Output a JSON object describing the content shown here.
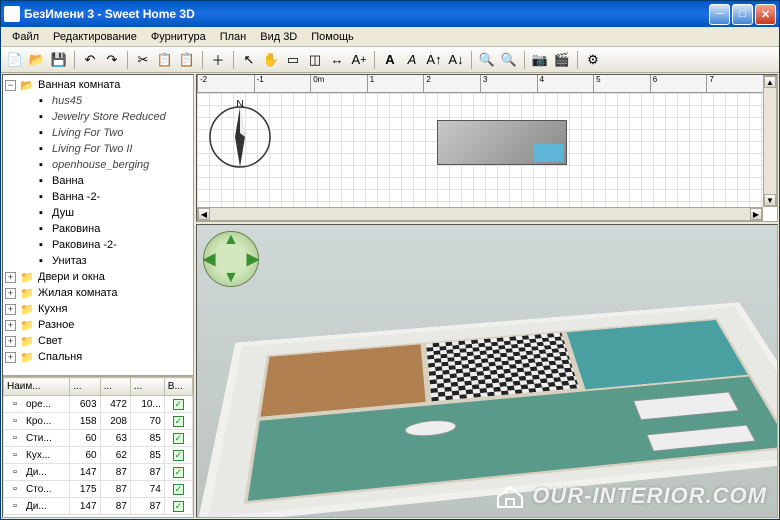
{
  "window": {
    "title": "БезИмени 3 - Sweet Home 3D"
  },
  "menu": {
    "file": "Файл",
    "edit": "Редактирование",
    "furniture": "Фурнитура",
    "plan": "План",
    "view3d": "Вид 3D",
    "help": "Помощь"
  },
  "tree": {
    "root": "Ванная комната",
    "items": [
      {
        "label": "hus45",
        "italic": true
      },
      {
        "label": "Jewelry Store Reduced",
        "italic": true
      },
      {
        "label": "Living For Two",
        "italic": true
      },
      {
        "label": "Living For Two II",
        "italic": true
      },
      {
        "label": "openhouse_berging",
        "italic": true
      },
      {
        "label": "Ванна",
        "italic": false
      },
      {
        "label": "Ванна -2-",
        "italic": false
      },
      {
        "label": "Душ",
        "italic": false
      },
      {
        "label": "Раковина",
        "italic": false
      },
      {
        "label": "Раковина -2-",
        "italic": false
      },
      {
        "label": "Унитаз",
        "italic": false
      }
    ],
    "siblings": [
      "Двери и окна",
      "Жилая комната",
      "Кухня",
      "Разное",
      "Свет",
      "Спальня"
    ]
  },
  "table": {
    "headers": [
      "Наим...",
      "...",
      "...",
      "...",
      "В..."
    ],
    "rows": [
      {
        "name": "ope...",
        "c1": "603",
        "c2": "472",
        "c3": "10...",
        "vis": true
      },
      {
        "name": "Кро...",
        "c1": "158",
        "c2": "208",
        "c3": "70",
        "vis": true
      },
      {
        "name": "Сти...",
        "c1": "60",
        "c2": "63",
        "c3": "85",
        "vis": true
      },
      {
        "name": "Кух...",
        "c1": "60",
        "c2": "62",
        "c3": "85",
        "vis": true
      },
      {
        "name": "Ди...",
        "c1": "147",
        "c2": "87",
        "c3": "87",
        "vis": true
      },
      {
        "name": "Сто...",
        "c1": "175",
        "c2": "87",
        "c3": "74",
        "vis": true
      },
      {
        "name": "Ди...",
        "c1": "147",
        "c2": "87",
        "c3": "87",
        "vis": true
      }
    ]
  },
  "ruler": {
    "ticks": [
      "-2",
      "-1",
      "0m",
      "1",
      "2",
      "3",
      "4",
      "5",
      "6",
      "7"
    ]
  },
  "compass": {
    "north": "N"
  },
  "watermark": "OUR-INTERIOR.COM"
}
